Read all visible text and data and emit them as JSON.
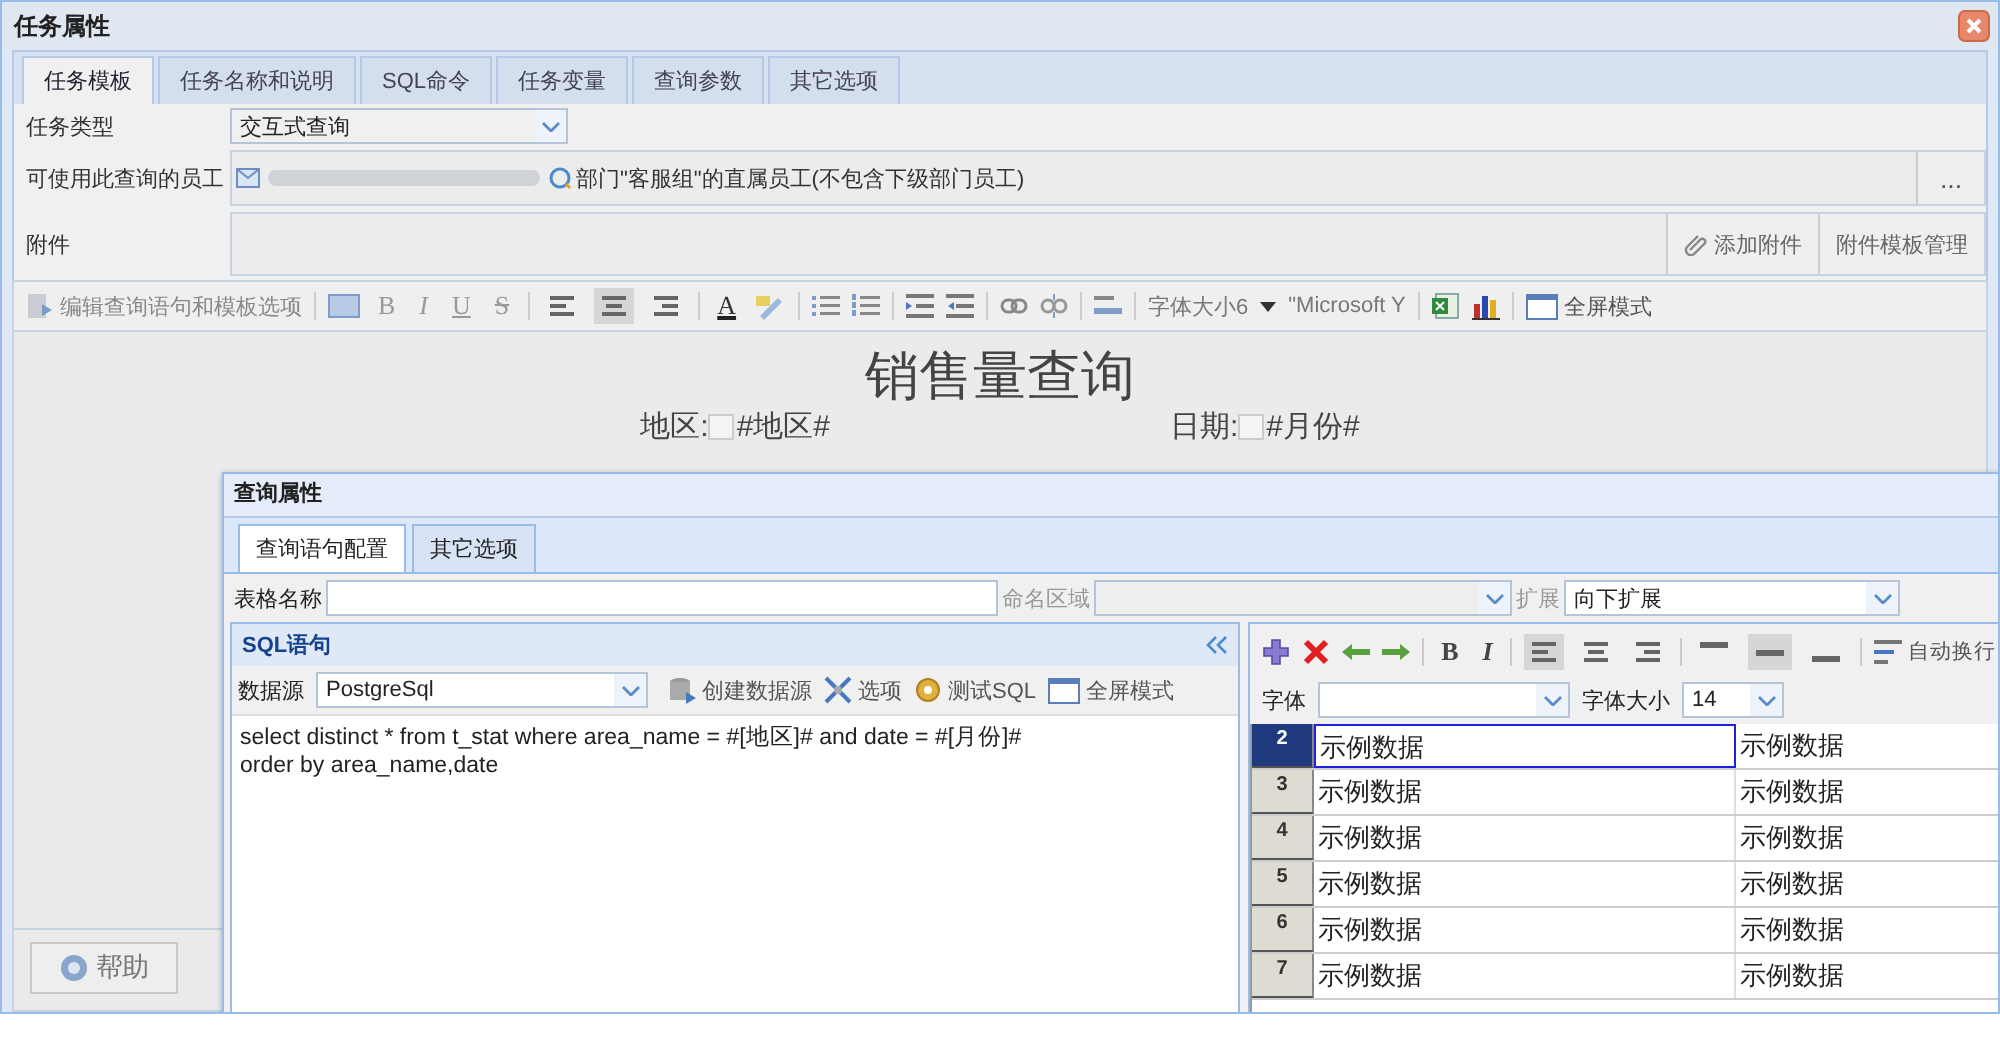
{
  "window": {
    "title": "任务属性"
  },
  "tabs": [
    {
      "label": "任务模板",
      "selected": true
    },
    {
      "label": "任务名称和说明",
      "selected": false
    },
    {
      "label": "SQL命令",
      "selected": false
    },
    {
      "label": "任务变量",
      "selected": false
    },
    {
      "label": "查询参数",
      "selected": false
    },
    {
      "label": "其它选项",
      "selected": false
    }
  ],
  "form": {
    "task_type": {
      "label": "任务类型",
      "value": "交互式查询"
    },
    "employees": {
      "label": "可使用此查询的员工",
      "department": "部门\"客服组\"的直属员工(不包含下级部门员工)",
      "more_button": "..."
    },
    "attachments": {
      "label": "附件",
      "buttons": [
        "添加附件",
        "附件模板管理"
      ]
    }
  },
  "editor_toolbar": {
    "edit_button": "编辑查询语句和模板选项",
    "format_glyphs": [
      "B",
      "I",
      "U",
      "S"
    ],
    "align": [
      {
        "selected": false
      },
      {
        "selected": true
      },
      {
        "selected": false
      }
    ],
    "color_glyph": "A",
    "font_size": "字体大小6",
    "font_name": "\"Microsoft Y",
    "fullscreen": "全屏模式"
  },
  "document": {
    "title": "销售量查询",
    "fields": [
      {
        "label": "地区:",
        "value": "#地区#"
      },
      {
        "label": "日期:",
        "value": "#月份#"
      }
    ]
  },
  "help_button": "帮助",
  "query_dialog": {
    "title": "查询属性",
    "tabs": [
      {
        "label": "查询语句配置",
        "selected": true
      },
      {
        "label": "其它选项",
        "selected": false
      }
    ],
    "table_name_label": "表格名称",
    "named_range_label": "命名区域",
    "expand_label": "扩展",
    "expand_value": "向下扩展",
    "sql_panel": {
      "title": "SQL语句",
      "datasource_label": "数据源",
      "datasource": "PostgreSql",
      "actions": [
        "创建数据源",
        "选项",
        "测试SQL",
        "全屏模式"
      ],
      "sql": [
        "select distinct * from t_stat where area_name = #[地区]# and date = #[月份]#",
        "order by area_name,date"
      ]
    },
    "grid_toolbar": {
      "glyphs": [
        "B",
        "I"
      ],
      "h_align": [
        {
          "selected": true
        },
        {
          "selected": false
        },
        {
          "selected": false
        }
      ],
      "v_align": [
        {
          "selected": false
        },
        {
          "selected": true
        },
        {
          "selected": false
        }
      ],
      "wrap": "自动换行",
      "font_label": "字体",
      "size_label": "字体大小",
      "size_value": "14"
    },
    "rows": [
      {
        "number": "2",
        "selected": true,
        "cells": [
          "示例数据",
          "示例数据"
        ]
      },
      {
        "number": "3",
        "selected": false,
        "cells": [
          "示例数据",
          "示例数据"
        ]
      },
      {
        "number": "4",
        "selected": false,
        "cells": [
          "示例数据",
          "示例数据"
        ]
      },
      {
        "number": "5",
        "selected": false,
        "cells": [
          "示例数据",
          "示例数据"
        ]
      },
      {
        "number": "6",
        "selected": false,
        "cells": [
          "示例数据",
          "示例数据"
        ]
      },
      {
        "number": "7",
        "selected": false,
        "cells": [
          "示例数据",
          "示例数据"
        ]
      }
    ]
  }
}
